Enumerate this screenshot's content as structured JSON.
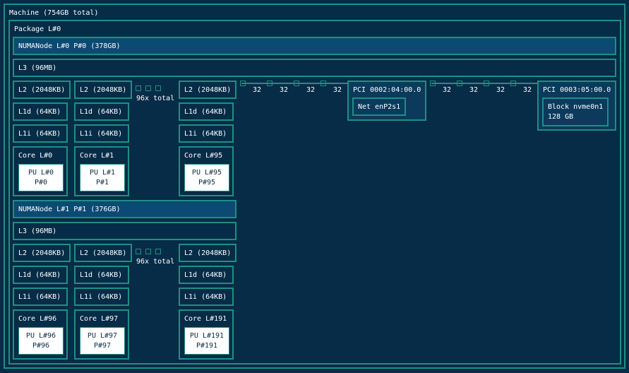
{
  "machine": {
    "label": "Machine (754GB total)"
  },
  "package": {
    "label": "Package L#0"
  },
  "numa0": {
    "label": "NUMANode L#0 P#0 (378GB)",
    "l3": "L3 (96MB)",
    "cores": [
      {
        "l2": "L2 (2048KB)",
        "l1d": "L1d (64KB)",
        "l1i": "L1i (64KB)",
        "core": "Core L#0",
        "pu1": "PU L#0",
        "pu2": "P#0"
      },
      {
        "l2": "L2 (2048KB)",
        "l1d": "L1d (64KB)",
        "l1i": "L1i (64KB)",
        "core": "Core L#1",
        "pu1": "PU L#1",
        "pu2": "P#1"
      },
      {
        "l2": "L2 (2048KB)",
        "l1d": "L1d (64KB)",
        "l1i": "L1i (64KB)",
        "core": "Core L#95",
        "pu1": "PU L#95",
        "pu2": "P#95"
      }
    ],
    "total": "96x total"
  },
  "numa1": {
    "label": "NUMANode L#1 P#1 (376GB)",
    "l3": "L3 (96MB)",
    "cores": [
      {
        "l2": "L2 (2048KB)",
        "l1d": "L1d (64KB)",
        "l1i": "L1i (64KB)",
        "core": "Core L#96",
        "pu1": "PU L#96",
        "pu2": "P#96"
      },
      {
        "l2": "L2 (2048KB)",
        "l1d": "L1d (64KB)",
        "l1i": "L1i (64KB)",
        "core": "Core L#97",
        "pu1": "PU L#97",
        "pu2": "P#97"
      },
      {
        "l2": "L2 (2048KB)",
        "l1d": "L1d (64KB)",
        "l1i": "L1i (64KB)",
        "core": "Core L#191",
        "pu1": "PU L#191",
        "pu2": "P#191"
      }
    ],
    "total": "96x total"
  },
  "bus": {
    "links1": [
      "32",
      "32",
      "32",
      "32"
    ],
    "links2": [
      "32",
      "32",
      "32",
      "32"
    ]
  },
  "pci1": {
    "label": "PCI 0002:04:00.0",
    "child": "Net enP2s1"
  },
  "pci2": {
    "label": "PCI 0003:05:00.0",
    "child1": "Block nvme0n1",
    "child2": "128 GB"
  }
}
